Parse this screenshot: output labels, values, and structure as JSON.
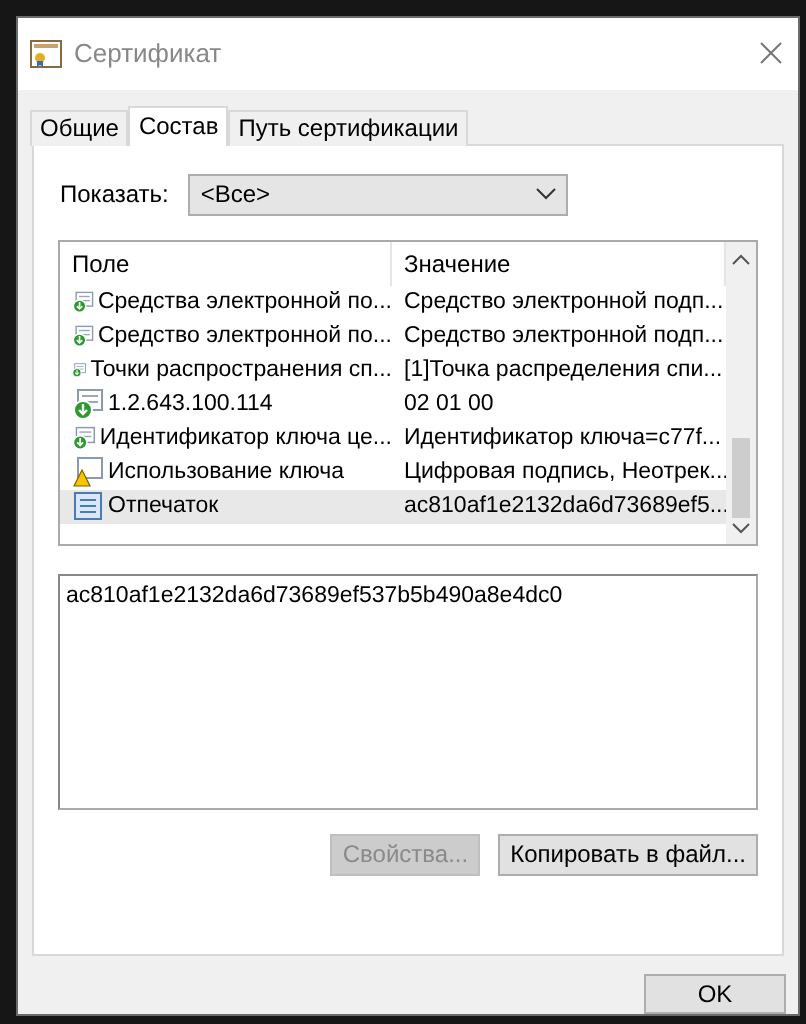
{
  "window": {
    "title": "Сертификат"
  },
  "tabs": [
    {
      "label": "Общие",
      "selected": false
    },
    {
      "label": "Состав",
      "selected": true
    },
    {
      "label": "Путь сертификации",
      "selected": false
    }
  ],
  "show": {
    "label": "Показать:",
    "value": "<Все>"
  },
  "table": {
    "columns": [
      "Поле",
      "Значение"
    ],
    "rows": [
      {
        "kind": "extension",
        "field": "Средства электронной по...",
        "value": "Средство электронной подп...",
        "selected": false
      },
      {
        "kind": "extension",
        "field": "Средство электронной по...",
        "value": "Средство электронной подп...",
        "selected": false
      },
      {
        "kind": "extension",
        "field": "Точки распространения сп...",
        "value": "[1]Точка распределения спи...",
        "selected": false
      },
      {
        "kind": "extension",
        "field": "1.2.643.100.114",
        "value": "02 01 00",
        "selected": false
      },
      {
        "kind": "extension",
        "field": "Идентификатор ключа це...",
        "value": "Идентификатор ключа=c77f...",
        "selected": false
      },
      {
        "kind": "warning",
        "field": "Использование ключа",
        "value": "Цифровая подпись, Неотрек...",
        "selected": false
      },
      {
        "kind": "property",
        "field": "Отпечаток",
        "value": "ac810af1e2132da6d73689ef5...",
        "selected": true
      }
    ]
  },
  "detail": {
    "value": "ac810af1e2132da6d73689ef537b5b490a8e4dc0"
  },
  "buttons": [
    {
      "label": "Свойства...",
      "disabled": true
    },
    {
      "label": "Копировать в файл...",
      "disabled": false
    }
  ],
  "ok_button": {
    "label": "OK"
  }
}
